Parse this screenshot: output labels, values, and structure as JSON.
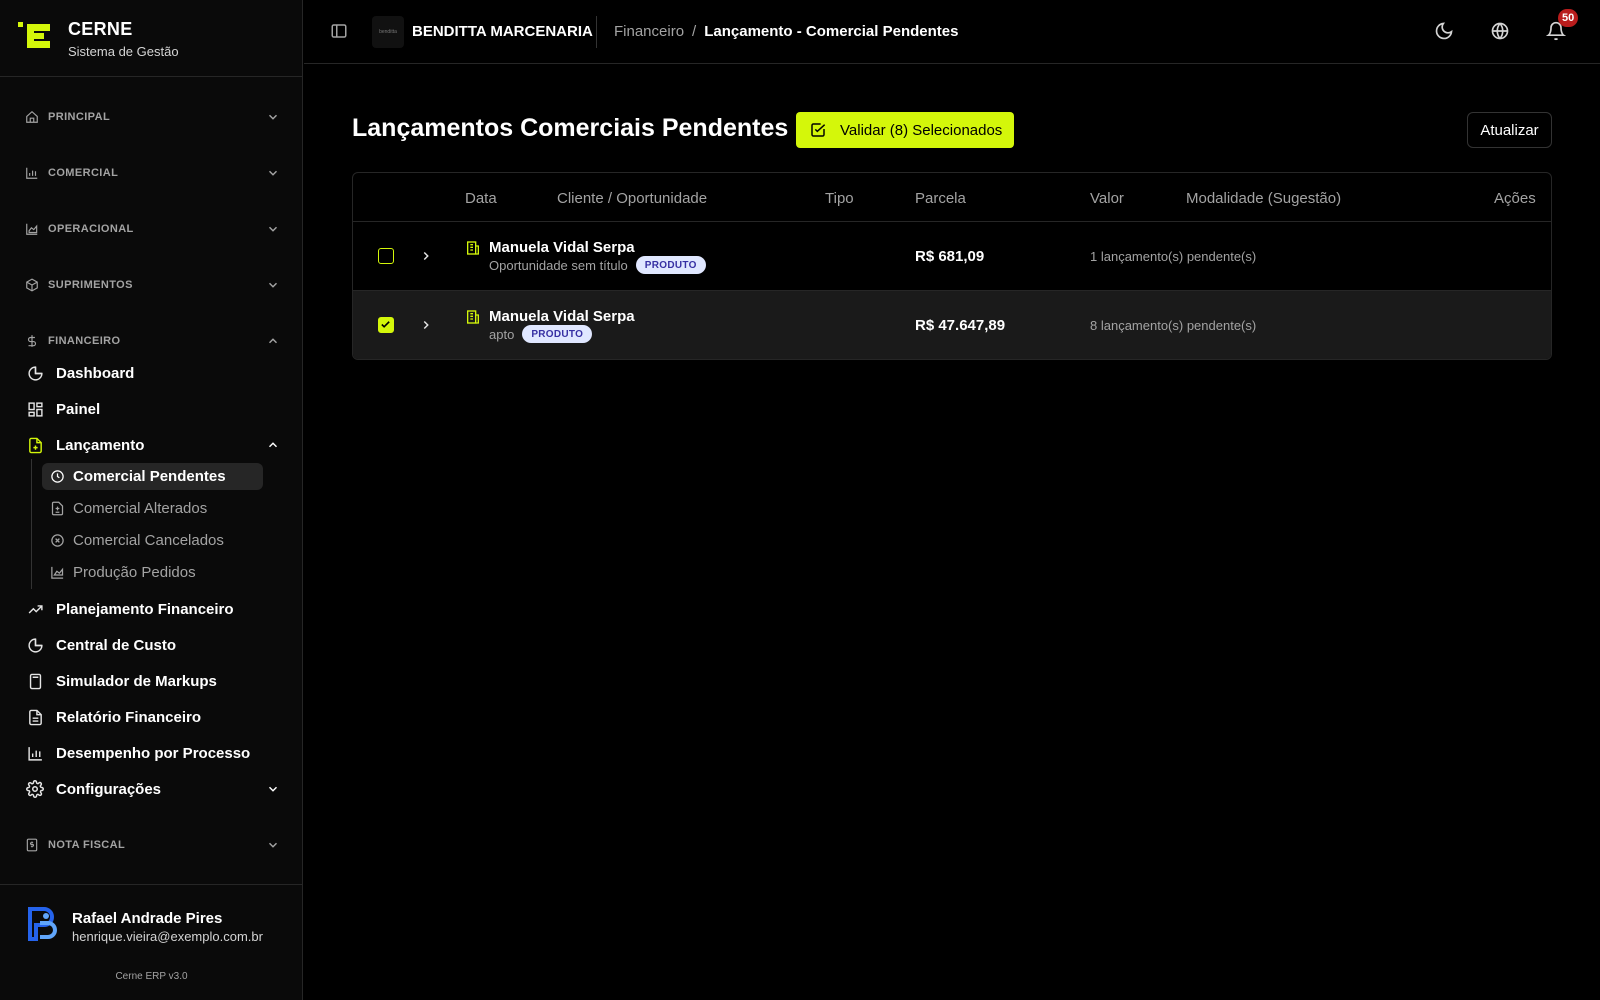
{
  "brand": {
    "name": "CERNE",
    "subtitle": "Sistema de Gestão"
  },
  "sidebar": {
    "groups": {
      "principal": "PRINCIPAL",
      "comercial": "COMERCIAL",
      "operacional": "OPERACIONAL",
      "suprimentos": "SUPRIMENTOS",
      "financeiro": "FINANCEIRO",
      "nota_fiscal": "NOTA FISCAL"
    },
    "financeiro_items": {
      "dashboard": "Dashboard",
      "painel": "Painel",
      "lancamento": "Lançamento",
      "planejamento": "Planejamento Financeiro",
      "central_custo": "Central de Custo",
      "simulador": "Simulador de Markups",
      "relatorio": "Relatório Financeiro",
      "desempenho": "Desempenho por Processo",
      "configuracoes": "Configurações"
    },
    "lancamento_sub": {
      "comercial_pendentes": "Comercial Pendentes",
      "comercial_alterados": "Comercial Alterados",
      "comercial_cancelados": "Comercial Cancelados",
      "producao_pedidos": "Produção Pedidos"
    }
  },
  "user": {
    "name": "Rafael Andrade Pires",
    "email": "henrique.vieira@exemplo.com.br",
    "version": "Cerne ERP v3.0"
  },
  "header": {
    "company": "BENDITTA MARCENARIA",
    "company_logo_text": "benditta",
    "breadcrumb": {
      "parent": "Financeiro",
      "separator": "/",
      "current": "Lançamento - Comercial Pendentes"
    },
    "notifications_count": "50"
  },
  "main": {
    "title": "Lançamentos Comerciais Pendentes",
    "validate_label": "Validar (8) Selecionados",
    "refresh_label": "Atualizar",
    "table": {
      "headers": {
        "data": "Data",
        "cliente": "Cliente / Oportunidade",
        "tipo": "Tipo",
        "parcela": "Parcela",
        "valor": "Valor",
        "modalidade": "Modalidade (Sugestão)",
        "acoes": "Ações"
      },
      "rows": [
        {
          "client": "Manuela Vidal Serpa",
          "opportunity": "Oportunidade sem título",
          "tag": "PRODUTO",
          "value": "R$ 681,09",
          "pending": "1 lançamento(s) pendente(s)",
          "checked": false
        },
        {
          "client": "Manuela Vidal Serpa",
          "opportunity": "apto",
          "tag": "PRODUTO",
          "value": "R$ 47.647,89",
          "pending": "8 lançamento(s) pendente(s)",
          "checked": true
        }
      ]
    }
  },
  "colors": {
    "accent": "#d4f70a",
    "background": "#000000",
    "sidebar": "#0a0a0a",
    "badge": "#b91c1c"
  }
}
